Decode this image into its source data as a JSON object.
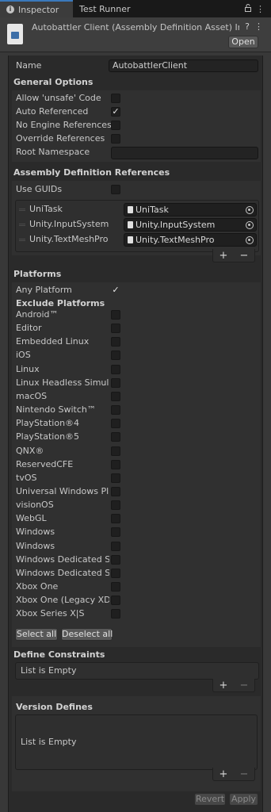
{
  "tabs": [
    {
      "label": "Inspector",
      "active": true
    },
    {
      "label": "Test Runner",
      "active": false
    }
  ],
  "tab_icons": [
    "lock-icon",
    "more-menu-icon"
  ],
  "header": {
    "title": "Autobattler Client (Assembly Definition Asset) Imp",
    "open_label": "Open",
    "help_icon": "?",
    "settings_icon": "⋮"
  },
  "name": {
    "label": "Name",
    "value": "AutobattlerClient"
  },
  "general": {
    "title": "General Options",
    "options": [
      {
        "label": "Allow 'unsafe' Code",
        "checked": false
      },
      {
        "label": "Auto Referenced",
        "checked": true
      },
      {
        "label": "No Engine References",
        "checked": false
      },
      {
        "label": "Override References",
        "checked": false
      }
    ],
    "root_namespace_label": "Root Namespace",
    "root_namespace_value": ""
  },
  "references": {
    "title": "Assembly Definition References",
    "use_guids_label": "Use GUIDs",
    "use_guids_checked": false,
    "items": [
      {
        "label": "UniTask",
        "value": "UniTask"
      },
      {
        "label": "Unity.InputSystem",
        "value": "Unity.InputSystem"
      },
      {
        "label": "Unity.TextMeshPro",
        "value": "Unity.TextMeshPro"
      }
    ],
    "add": "+",
    "remove": "−"
  },
  "platforms": {
    "title": "Platforms",
    "any_platform_label": "Any Platform",
    "any_platform_checked": true,
    "exclude_title": "Exclude Platforms",
    "items": [
      "Android™",
      "Editor",
      "Embedded Linux",
      "iOS",
      "Linux",
      "Linux Headless Simulation",
      "macOS",
      "Nintendo Switch™",
      "PlayStation®4",
      "PlayStation®5",
      "QNX®",
      "ReservedCFE",
      "tvOS",
      "Universal Windows Platform",
      "visionOS",
      "WebGL",
      "Windows",
      "Windows",
      "Windows Dedicated Server",
      "Windows Dedicated Server",
      "Xbox One",
      "Xbox One (Legacy XDK)",
      "Xbox Series X|S"
    ],
    "select_all": "Select all",
    "deselect_all": "Deselect all"
  },
  "define_constraints": {
    "title": "Define Constraints",
    "empty": "List is Empty",
    "add": "+",
    "remove": "−"
  },
  "version_defines": {
    "title": "Version Defines",
    "empty": "List is Empty",
    "add": "+",
    "remove": "−"
  },
  "footer": {
    "revert": "Revert",
    "apply": "Apply"
  },
  "colors": {
    "accent": "#3a79bb",
    "background": "#383838",
    "panel": "#2a2a2a"
  }
}
